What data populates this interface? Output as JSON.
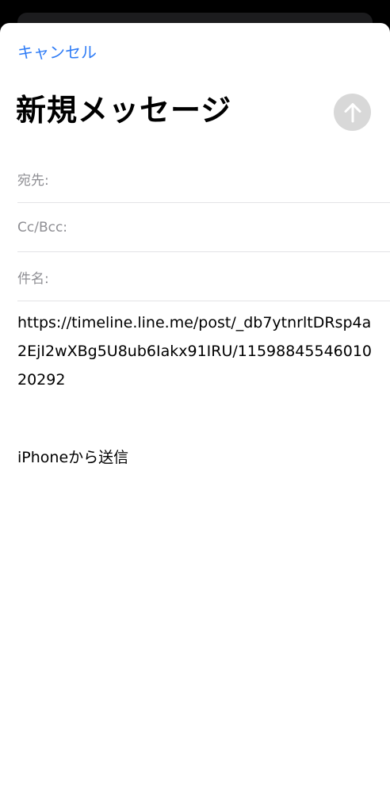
{
  "header": {
    "cancel_label": "キャンセル",
    "title": "新規メッセージ"
  },
  "fields": {
    "to_label": "宛先:",
    "cc_label": "Cc/Bcc:",
    "subject_label": "件名:"
  },
  "body": {
    "url": "https://timeline.line.me/post/_db7ytnrltDRsp4a2EjI2wXBg5U8ub6Iakx91IRU/1159884554601020292",
    "signature": "iPhoneから送信"
  },
  "icons": {
    "send": "arrow-up-icon"
  },
  "colors": {
    "accent": "#2f7cf6",
    "send_disabled": "#d8d8d8"
  }
}
